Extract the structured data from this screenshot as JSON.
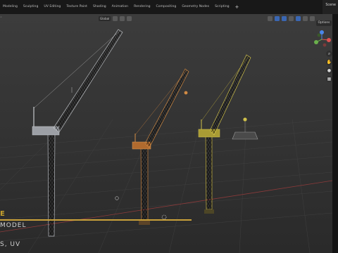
{
  "tabs": [
    "Modeling",
    "Sculpting",
    "UV Editing",
    "Texture Paint",
    "Shading",
    "Animation",
    "Rendering",
    "Compositing",
    "Geometry Nodes",
    "Scripting",
    "+"
  ],
  "scene_label": "Scene",
  "viewport_header": {
    "shading_mode": "Global",
    "options_label": "Options"
  },
  "overlay": {
    "title_fragment": "E",
    "subtitle": "MODEL",
    "line3": "S, UV"
  },
  "colors": {
    "accent_gold": "#c9a13a",
    "crane_gray": "#b9bcc2",
    "crane_orange": "#c9813e",
    "crane_yellow": "#c8b43c"
  },
  "icons": [
    "zoom-icon",
    "hand-icon",
    "camera-icon",
    "grid-icon",
    "axis-gizmo-icon"
  ]
}
